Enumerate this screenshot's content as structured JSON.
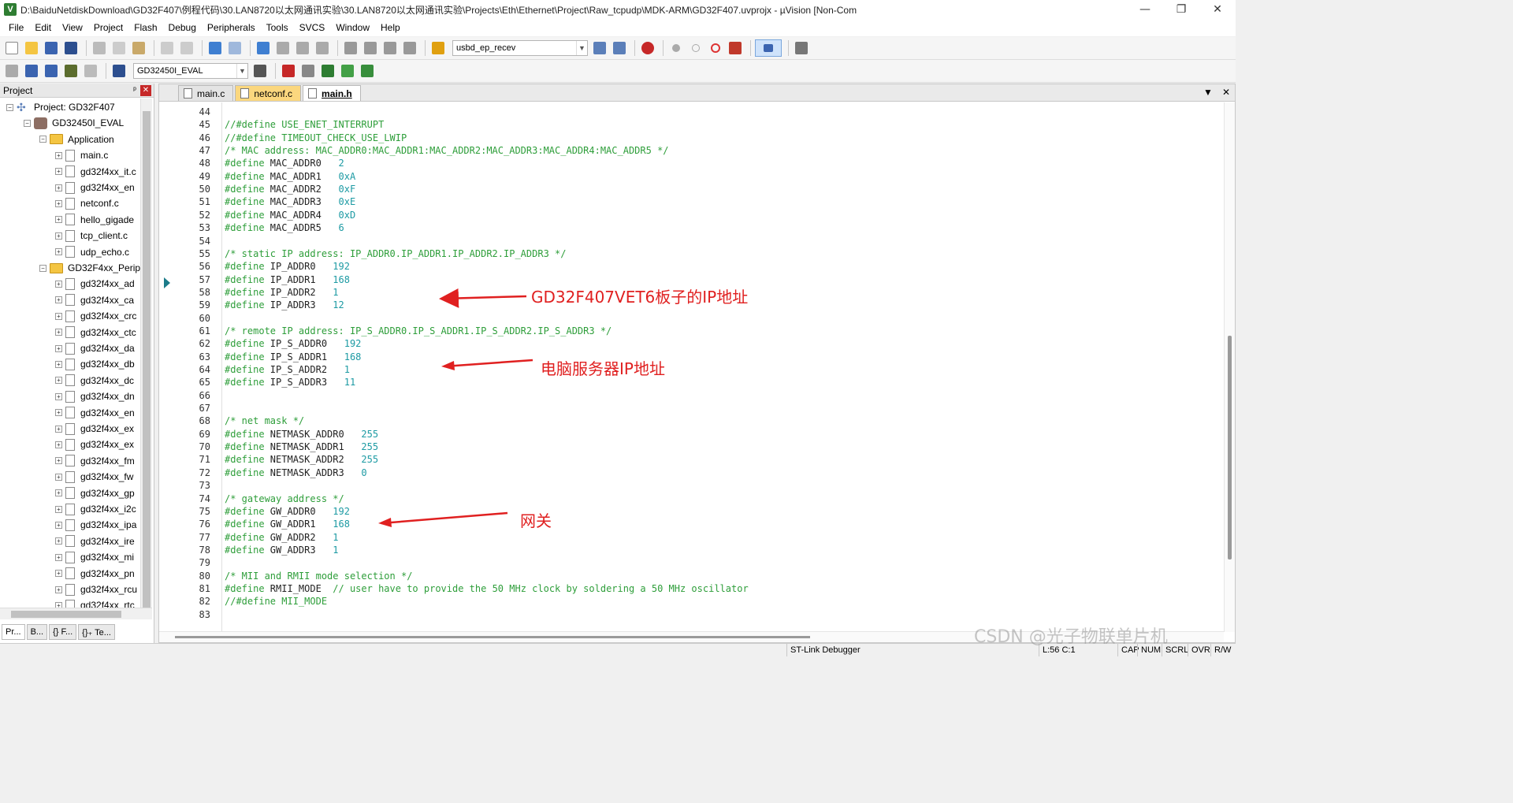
{
  "window": {
    "title": "D:\\BaiduNetdiskDownload\\GD32F407\\例程代码\\30.LAN8720以太网通讯实验\\30.LAN8720以太网通讯实验\\Projects\\Eth\\Ethernet\\Project\\Raw_tcpudp\\MDK-ARM\\GD32F407.uvprojx - µVision  [Non-Com",
    "app_icon": "V"
  },
  "menu": [
    "File",
    "Edit",
    "View",
    "Project",
    "Flash",
    "Debug",
    "Peripherals",
    "Tools",
    "SVCS",
    "Window",
    "Help"
  ],
  "toolbar": {
    "find_combo": "usbd_ep_recev",
    "target_combo": "GD32450I_EVAL"
  },
  "project_panel": {
    "title": "Project",
    "pin": "ᵖ",
    "close": "✕",
    "root": "Project: GD32F407",
    "target": "GD32450I_EVAL",
    "groups": [
      {
        "name": "Application",
        "files": [
          "main.c",
          "gd32f4xx_it.c",
          "gd32f4xx_en",
          "netconf.c",
          "hello_gigade",
          "tcp_client.c",
          "udp_echo.c"
        ]
      },
      {
        "name": "GD32F4xx_Peripl",
        "files": [
          "gd32f4xx_ad",
          "gd32f4xx_ca",
          "gd32f4xx_crc",
          "gd32f4xx_ctc",
          "gd32f4xx_da",
          "gd32f4xx_db",
          "gd32f4xx_dc",
          "gd32f4xx_dn",
          "gd32f4xx_en",
          "gd32f4xx_ex",
          "gd32f4xx_ex",
          "gd32f4xx_fm",
          "gd32f4xx_fw",
          "gd32f4xx_gp",
          "gd32f4xx_i2c",
          "gd32f4xx_ipa",
          "gd32f4xx_ire",
          "gd32f4xx_mi",
          "gd32f4xx_pn",
          "gd32f4xx_rcu",
          "gd32f4xx_rtc"
        ]
      }
    ],
    "bottom_tabs": [
      "Pr...",
      "B...",
      "{} F...",
      "{}₊ Te..."
    ]
  },
  "editor": {
    "tabs": [
      {
        "label": "main.c",
        "style": "normal"
      },
      {
        "label": "netconf.c",
        "style": "orange"
      },
      {
        "label": "main.h",
        "style": "active"
      }
    ],
    "lines": [
      {
        "n": "44",
        "parts": []
      },
      {
        "n": "45",
        "parts": [
          [
            "comment",
            "//#define USE_ENET_INTERRUPT"
          ]
        ]
      },
      {
        "n": "46",
        "parts": [
          [
            "comment",
            "//#define TIMEOUT_CHECK_USE_LWIP"
          ]
        ]
      },
      {
        "n": "47",
        "parts": [
          [
            "comment",
            "/* MAC address: MAC_ADDR0:MAC_ADDR1:MAC_ADDR2:MAC_ADDR3:MAC_ADDR4:MAC_ADDR5 */"
          ]
        ]
      },
      {
        "n": "48",
        "parts": [
          [
            "kw",
            "#define "
          ],
          [
            "ident",
            "MAC_ADDR0   "
          ],
          [
            "num",
            "2"
          ]
        ]
      },
      {
        "n": "49",
        "parts": [
          [
            "kw",
            "#define "
          ],
          [
            "ident",
            "MAC_ADDR1   "
          ],
          [
            "num",
            "0xA"
          ]
        ]
      },
      {
        "n": "50",
        "parts": [
          [
            "kw",
            "#define "
          ],
          [
            "ident",
            "MAC_ADDR2   "
          ],
          [
            "num",
            "0xF"
          ]
        ]
      },
      {
        "n": "51",
        "parts": [
          [
            "kw",
            "#define "
          ],
          [
            "ident",
            "MAC_ADDR3   "
          ],
          [
            "num",
            "0xE"
          ]
        ]
      },
      {
        "n": "52",
        "parts": [
          [
            "kw",
            "#define "
          ],
          [
            "ident",
            "MAC_ADDR4   "
          ],
          [
            "num",
            "0xD"
          ]
        ]
      },
      {
        "n": "53",
        "parts": [
          [
            "kw",
            "#define "
          ],
          [
            "ident",
            "MAC_ADDR5   "
          ],
          [
            "num",
            "6"
          ]
        ]
      },
      {
        "n": "54",
        "parts": []
      },
      {
        "n": "55",
        "parts": [
          [
            "comment",
            "/* static IP address: IP_ADDR0.IP_ADDR1.IP_ADDR2.IP_ADDR3 */"
          ]
        ]
      },
      {
        "n": "56",
        "parts": [
          [
            "kw",
            "#define "
          ],
          [
            "ident",
            "IP_ADDR0   "
          ],
          [
            "num",
            "192"
          ]
        ]
      },
      {
        "n": "57",
        "parts": [
          [
            "kw",
            "#define "
          ],
          [
            "ident",
            "IP_ADDR1   "
          ],
          [
            "num",
            "168"
          ]
        ]
      },
      {
        "n": "58",
        "parts": [
          [
            "kw",
            "#define "
          ],
          [
            "ident",
            "IP_ADDR2   "
          ],
          [
            "num",
            "1"
          ]
        ]
      },
      {
        "n": "59",
        "parts": [
          [
            "kw",
            "#define "
          ],
          [
            "ident",
            "IP_ADDR3   "
          ],
          [
            "num",
            "12"
          ]
        ]
      },
      {
        "n": "60",
        "parts": []
      },
      {
        "n": "61",
        "parts": [
          [
            "comment",
            "/* remote IP address: IP_S_ADDR0.IP_S_ADDR1.IP_S_ADDR2.IP_S_ADDR3 */"
          ]
        ]
      },
      {
        "n": "62",
        "parts": [
          [
            "kw",
            "#define "
          ],
          [
            "ident",
            "IP_S_ADDR0   "
          ],
          [
            "num",
            "192"
          ]
        ]
      },
      {
        "n": "63",
        "parts": [
          [
            "kw",
            "#define "
          ],
          [
            "ident",
            "IP_S_ADDR1   "
          ],
          [
            "num",
            "168"
          ]
        ]
      },
      {
        "n": "64",
        "parts": [
          [
            "kw",
            "#define "
          ],
          [
            "ident",
            "IP_S_ADDR2   "
          ],
          [
            "num",
            "1"
          ]
        ]
      },
      {
        "n": "65",
        "parts": [
          [
            "kw",
            "#define "
          ],
          [
            "ident",
            "IP_S_ADDR3   "
          ],
          [
            "num",
            "11"
          ]
        ]
      },
      {
        "n": "66",
        "parts": []
      },
      {
        "n": "67",
        "parts": []
      },
      {
        "n": "68",
        "parts": [
          [
            "comment",
            "/* net mask */"
          ]
        ]
      },
      {
        "n": "69",
        "parts": [
          [
            "kw",
            "#define "
          ],
          [
            "ident",
            "NETMASK_ADDR0   "
          ],
          [
            "num",
            "255"
          ]
        ]
      },
      {
        "n": "70",
        "parts": [
          [
            "kw",
            "#define "
          ],
          [
            "ident",
            "NETMASK_ADDR1   "
          ],
          [
            "num",
            "255"
          ]
        ]
      },
      {
        "n": "71",
        "parts": [
          [
            "kw",
            "#define "
          ],
          [
            "ident",
            "NETMASK_ADDR2   "
          ],
          [
            "num",
            "255"
          ]
        ]
      },
      {
        "n": "72",
        "parts": [
          [
            "kw",
            "#define "
          ],
          [
            "ident",
            "NETMASK_ADDR3   "
          ],
          [
            "num",
            "0"
          ]
        ]
      },
      {
        "n": "73",
        "parts": []
      },
      {
        "n": "74",
        "parts": [
          [
            "comment",
            "/* gateway address */"
          ]
        ]
      },
      {
        "n": "75",
        "parts": [
          [
            "kw",
            "#define "
          ],
          [
            "ident",
            "GW_ADDR0   "
          ],
          [
            "num",
            "192"
          ]
        ]
      },
      {
        "n": "76",
        "parts": [
          [
            "kw",
            "#define "
          ],
          [
            "ident",
            "GW_ADDR1   "
          ],
          [
            "num",
            "168"
          ]
        ]
      },
      {
        "n": "77",
        "parts": [
          [
            "kw",
            "#define "
          ],
          [
            "ident",
            "GW_ADDR2   "
          ],
          [
            "num",
            "1"
          ]
        ]
      },
      {
        "n": "78",
        "parts": [
          [
            "kw",
            "#define "
          ],
          [
            "ident",
            "GW_ADDR3   "
          ],
          [
            "num",
            "1"
          ]
        ]
      },
      {
        "n": "79",
        "parts": []
      },
      {
        "n": "80",
        "parts": [
          [
            "comment",
            "/* MII and RMII mode selection */"
          ]
        ]
      },
      {
        "n": "81",
        "parts": [
          [
            "kw",
            "#define "
          ],
          [
            "ident",
            "RMII_MODE  "
          ],
          [
            "comment",
            "// user have to provide the 50 MHz clock by soldering a 50 MHz oscillator"
          ]
        ]
      },
      {
        "n": "82",
        "parts": [
          [
            "comment",
            "//#define MII_MODE"
          ]
        ]
      },
      {
        "n": "83",
        "parts": []
      }
    ]
  },
  "annotations": {
    "board_ip": "GD32F407VET6板子的IP地址",
    "server_ip": "电脑服务器IP地址",
    "gateway": "网关",
    "color": "#e02020"
  },
  "status": {
    "debugger": "ST-Link Debugger",
    "position": "L:56 C:1",
    "caps": "CAP",
    "num": "NUM",
    "scrl": "SCRL",
    "ovr": "OVR",
    "rw": "R/W"
  },
  "watermark": "CSDN @光子物联单片机"
}
